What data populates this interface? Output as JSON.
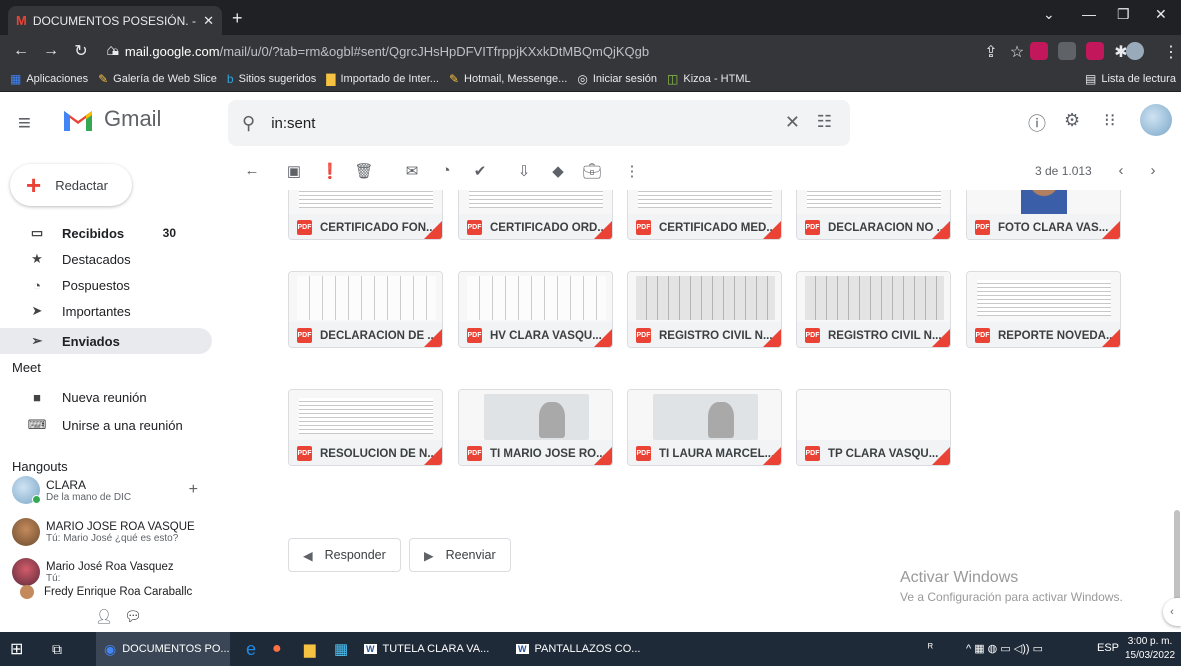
{
  "browser": {
    "tab_title": "DOCUMENTOS POSESIÓN. - cva",
    "tab_favicon": "gmail-m-icon",
    "url_host": "mail.google.com",
    "url_path": "/mail/u/0/?tab=rm&ogbl#sent/QgrcJHsHpDFVITfrppjKXxkDtMBQmQjKQgb",
    "bookmarks": [
      {
        "label": "Aplicaciones",
        "icon": "apps-icon"
      },
      {
        "label": "Galería de Web Slice",
        "icon": "ie-icon"
      },
      {
        "label": "Sitios sugeridos",
        "icon": "bing-icon"
      },
      {
        "label": "Importado de Inter...",
        "icon": "folder-icon"
      },
      {
        "label": "Hotmail, Messenge...",
        "icon": "ie-icon"
      },
      {
        "label": "Iniciar sesión",
        "icon": "globe-icon"
      },
      {
        "label": "Kizoa - HTML",
        "icon": "kizoa-icon"
      }
    ],
    "reading_list": "Lista de lectura"
  },
  "gmail": {
    "app_name": "Gmail",
    "search_value": "in:sent",
    "compose_label": "Redactar",
    "nav": [
      {
        "label": "Recibidos",
        "count": "30",
        "icon": "inbox-icon"
      },
      {
        "label": "Destacados",
        "count": "",
        "icon": "star-icon"
      },
      {
        "label": "Pospuestos",
        "count": "",
        "icon": "clock-icon"
      },
      {
        "label": "Importantes",
        "count": "",
        "icon": "important-icon"
      },
      {
        "label": "Enviados",
        "count": "",
        "icon": "send-icon"
      }
    ],
    "meet": {
      "title": "Meet",
      "items": [
        {
          "label": "Nueva reunión",
          "icon": "video-icon"
        },
        {
          "label": "Unirse a una reunión",
          "icon": "keyboard-icon"
        }
      ]
    },
    "hangouts": {
      "title": "Hangouts",
      "me_name": "CLARA",
      "me_status": "De la mano de DIC",
      "contacts": [
        {
          "name": "MARIO JOSE ROA VASQUE",
          "msg": "Tú: Mario José ¿qué es esto?"
        },
        {
          "name": "Mario José Roa Vasquez",
          "msg": "Tú:"
        },
        {
          "name": "Fredy Enrique Roa Caraballc",
          "msg": ""
        }
      ]
    },
    "pager": "3 de 1.013",
    "attachments": [
      {
        "name": "CERTIFICADO FON...",
        "thumb": "lines"
      },
      {
        "name": "CERTIFICADO ORD...",
        "thumb": "lines"
      },
      {
        "name": "CERTIFICADO MED...",
        "thumb": "lines"
      },
      {
        "name": "DECLARACIÓN NO ...",
        "thumb": "lines"
      },
      {
        "name": "FOTO CLARA VAS...",
        "thumb": "photo"
      },
      {
        "name": "DECLARACIÓN DE ...",
        "thumb": "form"
      },
      {
        "name": "HV CLARA VASQU...",
        "thumb": "form"
      },
      {
        "name": "REGISTRO CIVIL N...",
        "thumb": "form"
      },
      {
        "name": "REGISTRO CIVIL N...",
        "thumb": "form"
      },
      {
        "name": "REPORTE NOVEDA...",
        "thumb": "form"
      },
      {
        "name": "RESOLUCIÓN DE N...",
        "thumb": "lines"
      },
      {
        "name": "TI MARIO JOSE RO...",
        "thumb": "idcard"
      },
      {
        "name": "TI LAURA MARCEL...",
        "thumb": "idcard"
      },
      {
        "name": "TP CLARA VASQU...",
        "thumb": "blank"
      }
    ],
    "reply_label": "Responder",
    "forward_label": "Reenviar"
  },
  "watermark": {
    "line1": "Activar Windows",
    "line2": "Ve a Configuración para activar Windows."
  },
  "taskbar": {
    "items": [
      {
        "label": "DOCUMENTOS PO...",
        "icon": "chrome-icon"
      },
      {
        "label": "TUTELA CLARA VA...",
        "icon": "word-icon"
      },
      {
        "label": "PANTALLAZOS CO...",
        "icon": "word-icon"
      }
    ],
    "lang": "ESP",
    "time": "3:00 p. m.",
    "date": "15/03/2022"
  },
  "colors": {
    "accent_red": "#ea4335",
    "chrome_dark": "#35363a",
    "taskbar": "#1f2a38"
  }
}
